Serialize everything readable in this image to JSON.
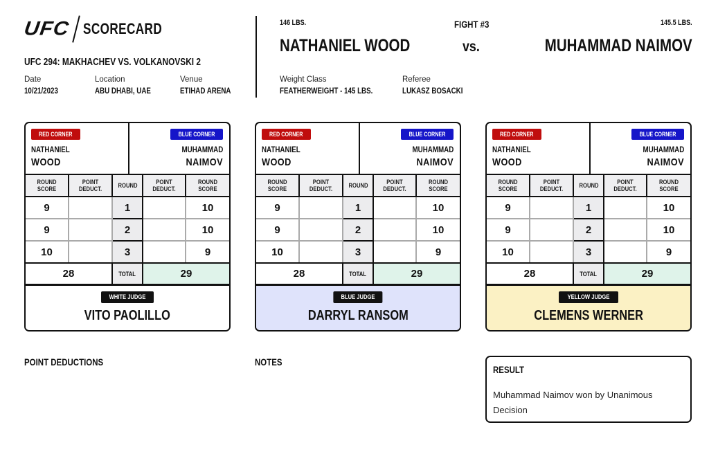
{
  "header": {
    "logo_brand": "UFC",
    "logo_title": "SCORECARD",
    "event_title": "UFC 294: MAKHACHEV VS. VOLKANOVSKI 2",
    "date_label": "Date",
    "date_value": "10/21/2023",
    "location_label": "Location",
    "location_value": "ABU DHABI, UAE",
    "venue_label": "Venue",
    "venue_value": "ETIHAD ARENA"
  },
  "fight": {
    "number": "FIGHT #3",
    "vs": "vs.",
    "red_weight": "146 LBS.",
    "blue_weight": "145.5 LBS.",
    "red_name": "NATHANIEL WOOD",
    "blue_name": "MUHAMMAD NAIMOV",
    "weight_class_label": "Weight Class",
    "weight_class_value": "FEATHERWEIGHT - 145 LBS.",
    "referee_label": "Referee",
    "referee_value": "LUKASZ BOSACKI"
  },
  "labels": {
    "red_corner": "RED CORNER",
    "blue_corner": "BLUE CORNER",
    "red_first": "NATHANIEL",
    "red_last": "WOOD",
    "blue_first": "MUHAMMAD",
    "blue_last": "NAIMOV",
    "col_round_score": "ROUND SCORE",
    "col_point_deduct": "POINT DEDUCT.",
    "col_round": "ROUND",
    "total": "TOTAL"
  },
  "colors": {
    "red_corner": "#c00d0d",
    "blue_corner": "#1515c9",
    "winner_total_bg": "#dff3ea",
    "white_judge_bg": "#ffffff",
    "blue_judge_bg": "#dfe3fb",
    "yellow_judge_bg": "#fbf1c4"
  },
  "cards": [
    {
      "judge_badge": "WHITE JUDGE",
      "judge_name": "VITO PAOLILLO",
      "rounds": [
        {
          "round": "1",
          "red_score": "9",
          "red_deduct": "",
          "blue_deduct": "",
          "blue_score": "10"
        },
        {
          "round": "2",
          "red_score": "9",
          "red_deduct": "",
          "blue_deduct": "",
          "blue_score": "10"
        },
        {
          "round": "3",
          "red_score": "10",
          "red_deduct": "",
          "blue_deduct": "",
          "blue_score": "9"
        }
      ],
      "red_total": "28",
      "blue_total": "29"
    },
    {
      "judge_badge": "BLUE JUDGE",
      "judge_name": "DARRYL RANSOM",
      "rounds": [
        {
          "round": "1",
          "red_score": "9",
          "red_deduct": "",
          "blue_deduct": "",
          "blue_score": "10"
        },
        {
          "round": "2",
          "red_score": "9",
          "red_deduct": "",
          "blue_deduct": "",
          "blue_score": "10"
        },
        {
          "round": "3",
          "red_score": "10",
          "red_deduct": "",
          "blue_deduct": "",
          "blue_score": "9"
        }
      ],
      "red_total": "28",
      "blue_total": "29"
    },
    {
      "judge_badge": "YELLOW JUDGE",
      "judge_name": "CLEMENS WERNER",
      "rounds": [
        {
          "round": "1",
          "red_score": "9",
          "red_deduct": "",
          "blue_deduct": "",
          "blue_score": "10"
        },
        {
          "round": "2",
          "red_score": "9",
          "red_deduct": "",
          "blue_deduct": "",
          "blue_score": "10"
        },
        {
          "round": "3",
          "red_score": "10",
          "red_deduct": "",
          "blue_deduct": "",
          "blue_score": "9"
        }
      ],
      "red_total": "28",
      "blue_total": "29"
    }
  ],
  "bottom": {
    "point_deductions_title": "POINT DEDUCTIONS",
    "notes_title": "NOTES",
    "result_title": "RESULT",
    "result_text": "Muhammad Naimov won by Unanimous Decision"
  }
}
